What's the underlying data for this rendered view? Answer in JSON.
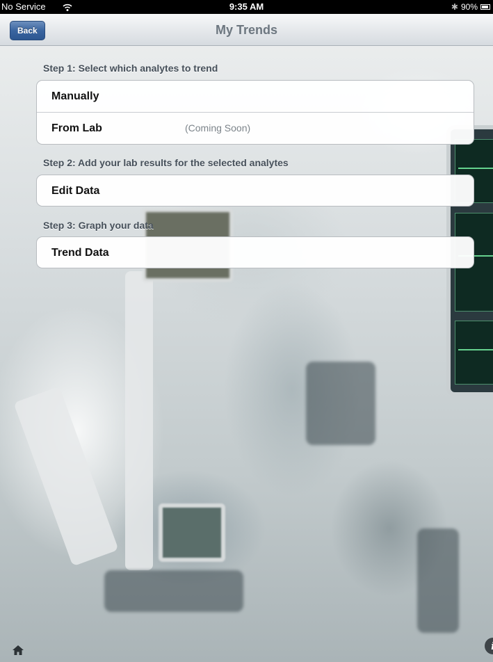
{
  "status_bar": {
    "carrier": "No Service",
    "wifi_icon": "wifi-icon",
    "time": "9:35 AM",
    "bluetooth_icon": "bluetooth-icon",
    "battery": "90%"
  },
  "nav_bar": {
    "back_label": "Back",
    "title": "My Trends"
  },
  "sections": [
    {
      "header": "Step 1: Select which analytes to trend",
      "rows": [
        {
          "label": "Manually",
          "detail": ""
        },
        {
          "label": "From Lab",
          "detail": "(Coming Soon)"
        }
      ]
    },
    {
      "header": "Step 2: Add your lab results for the selected analytes",
      "rows": [
        {
          "label": "Edit Data",
          "detail": ""
        }
      ]
    },
    {
      "header": "Step 3: Graph your data",
      "rows": [
        {
          "label": "Trend Data",
          "detail": ""
        }
      ]
    }
  ],
  "bottom_bar": {
    "home_icon": "home-icon",
    "info_icon": "info-icon",
    "info_glyph": "i"
  },
  "colors": {
    "nav_title": "#6d7780",
    "back_button": "#3a65a0",
    "section_header": "#46505a",
    "cell_detail": "#7c848a"
  }
}
